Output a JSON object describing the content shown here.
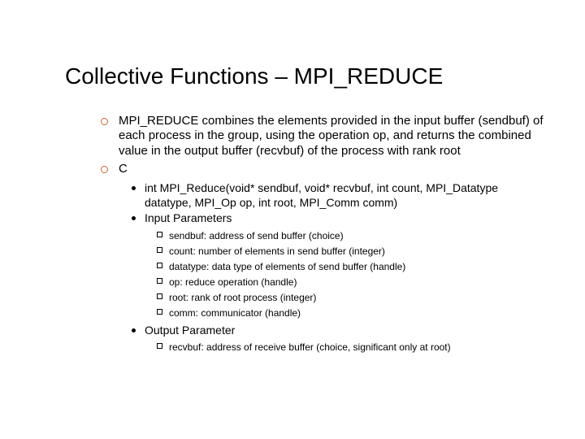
{
  "title": "Collective Functions – MPI_REDUCE",
  "b1": {
    "desc": "MPI_REDUCE combines the elements provided in the input buffer (sendbuf) of each process in the group, using the operation op, and returns the combined value in the output buffer (recvbuf) of the process with rank root",
    "lang": "C"
  },
  "b2": {
    "sig": "int MPI_Reduce(void* sendbuf, void* recvbuf, int count, MPI_Datatype datatype, MPI_Op op, int root, MPI_Comm comm)",
    "inparams": "Input Parameters",
    "outparam": "Output Parameter"
  },
  "in": {
    "p0": "sendbuf: address of send buffer (choice)",
    "p1": "count: number of elements in send buffer (integer)",
    "p2": "datatype: data type of elements of send buffer (handle)",
    "p3": "op: reduce operation (handle)",
    "p4": "root: rank of root process (integer)",
    "p5": "comm: communicator (handle)"
  },
  "out": {
    "p0": "recvbuf: address of receive buffer (choice, significant only at root)"
  }
}
